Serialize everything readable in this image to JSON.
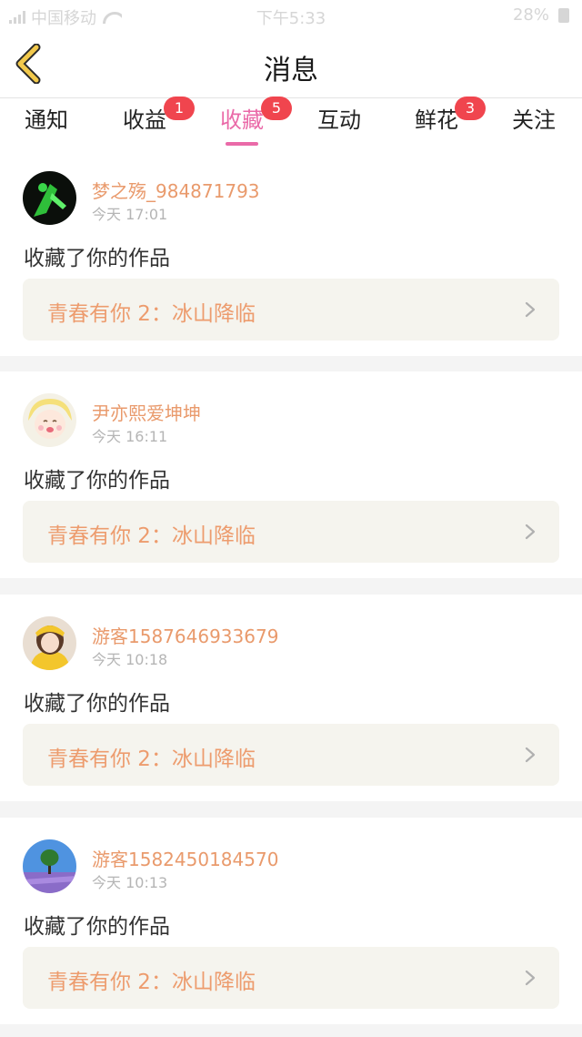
{
  "status_bar": {
    "carrier": "中国移动",
    "time": "下午5:33",
    "battery": "28%"
  },
  "header": {
    "title": "消息",
    "back_icon": "chevron-left-icon"
  },
  "tabs": [
    {
      "label": "通知",
      "badge": "",
      "active": false
    },
    {
      "label": "收益",
      "badge": "1",
      "active": false
    },
    {
      "label": "收藏",
      "badge": "5",
      "active": true
    },
    {
      "label": "互动",
      "badge": "",
      "active": false
    },
    {
      "label": "鲜花",
      "badge": "3",
      "active": false
    },
    {
      "label": "关注",
      "badge": "",
      "active": false
    }
  ],
  "messages": [
    {
      "username": "梦之殇_984871793",
      "time": "今天 17:01",
      "action": "收藏了你的作品",
      "work": "青春有你 2：冰山降临"
    },
    {
      "username": "尹亦熙爱坤坤",
      "time": "今天 16:11",
      "action": "收藏了你的作品",
      "work": "青春有你 2：冰山降临"
    },
    {
      "username": "游客1587646933679",
      "time": "今天 10:18",
      "action": "收藏了你的作品",
      "work": "青春有你 2：冰山降临"
    },
    {
      "username": "游客1582450184570",
      "time": "今天 10:13",
      "action": "收藏了你的作品",
      "work": "青春有你 2：冰山降临"
    }
  ],
  "colors": {
    "accent": "#ea6aa8",
    "badge": "#f0454e",
    "username": "#e99a6c",
    "back_icon": "#f2c94c"
  }
}
